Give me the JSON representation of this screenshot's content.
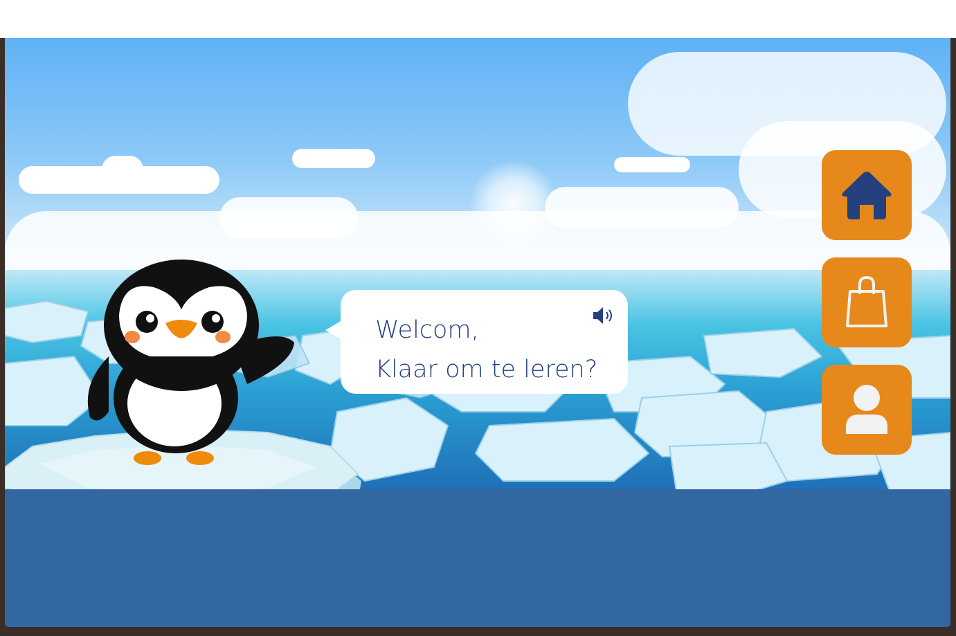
{
  "greeting": {
    "line1": "Welcom,",
    "line2": "Klaar om te leren?"
  },
  "icons": {
    "speaker": "speaker-icon",
    "home": "home-icon",
    "shop": "shopping-bag-icon",
    "profile": "user-icon"
  },
  "colors": {
    "button": "#e6891a",
    "text": "#24407f",
    "home_icon": "#24407f",
    "icon_light": "#f2f2f2",
    "ground": "#3367a1"
  }
}
